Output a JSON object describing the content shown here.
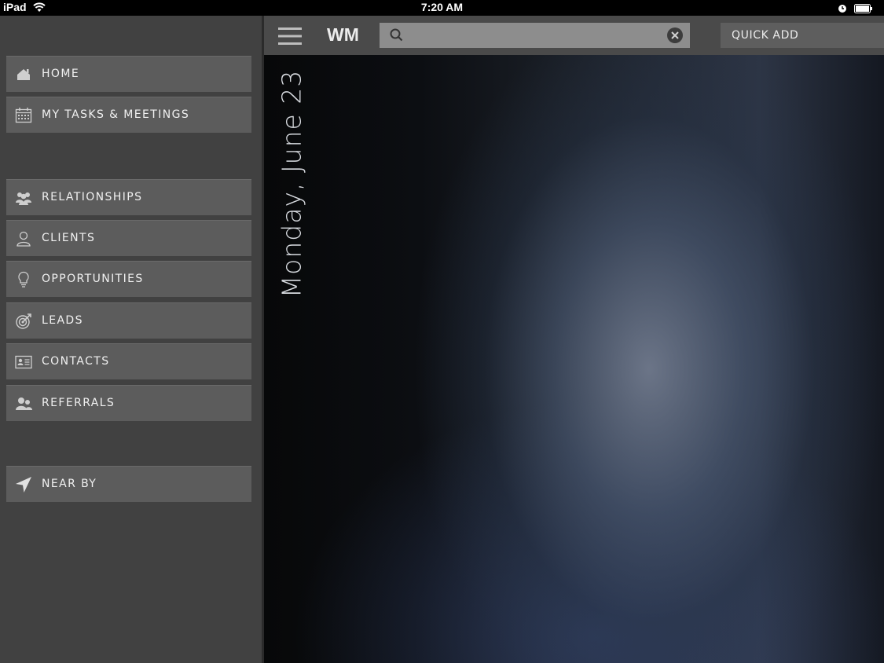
{
  "statusbar": {
    "device": "iPad",
    "time": "7:20 AM"
  },
  "topbar": {
    "app_title": "WM",
    "search": {
      "value": "",
      "placeholder": ""
    },
    "quick_add_label": "QUICK ADD"
  },
  "sidebar": {
    "items": [
      {
        "label": "HOME",
        "icon": "home-icon"
      },
      {
        "label": "MY TASKS & MEETINGS",
        "icon": "calendar-icon"
      },
      {
        "label": "RELATIONSHIPS",
        "icon": "people-icon"
      },
      {
        "label": "CLIENTS",
        "icon": "person-icon"
      },
      {
        "label": "OPPORTUNITIES",
        "icon": "lightbulb-icon"
      },
      {
        "label": "LEADS",
        "icon": "target-icon"
      },
      {
        "label": "CONTACTS",
        "icon": "contact-card-icon"
      },
      {
        "label": "REFERRALS",
        "icon": "referral-icon"
      },
      {
        "label": "NEAR BY",
        "icon": "location-arrow-icon"
      }
    ]
  },
  "main": {
    "date": "Monday, June 23"
  },
  "colors": {
    "sidebar_bg": "#414141",
    "nav_item_bg": "#5c5c5c",
    "topbar_bg": "#4a4a4a",
    "search_bg": "#8d8d8d",
    "quick_add_bg": "#5e5e5e"
  }
}
